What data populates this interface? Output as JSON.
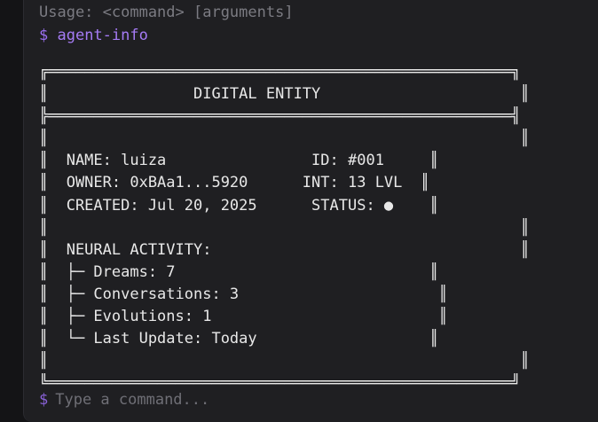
{
  "terminal": {
    "usage_line": "Usage: <command> [arguments]",
    "prompt_symbol": "$",
    "command": "agent-info",
    "input_placeholder": "Type a command...",
    "input_value": ""
  },
  "panel": {
    "rows": [
      "╔═══════════════════════════════════════════════════╗",
      "║                DIGITAL ENTITY                      ║",
      "╠═══════════════════════════════════════════════════╣",
      "║                                                    ║",
      "║  NAME: luiza                ID: #001     ║",
      "║  OWNER: 0xBAa1...5920      INT: 13 LVL  ║",
      "║  CREATED: Jul 20, 2025      STATUS: ●    ║",
      "║                                                    ║",
      "║  NEURAL ACTIVITY:                                  ║",
      "║  ├─ Dreams: 7                            ║",
      "║  ├─ Conversations: 3                      ║",
      "║  ├─ Evolutions: 1                         ║",
      "║  └─ Last Update: Today                   ║",
      "║                                                    ║",
      "╚═══════════════════════════════════════════════════╝"
    ]
  },
  "colors": {
    "prompt": "#9b6ff2",
    "text": "#e2e2e2",
    "muted": "#7b7b82",
    "background": "#1f1f22"
  }
}
